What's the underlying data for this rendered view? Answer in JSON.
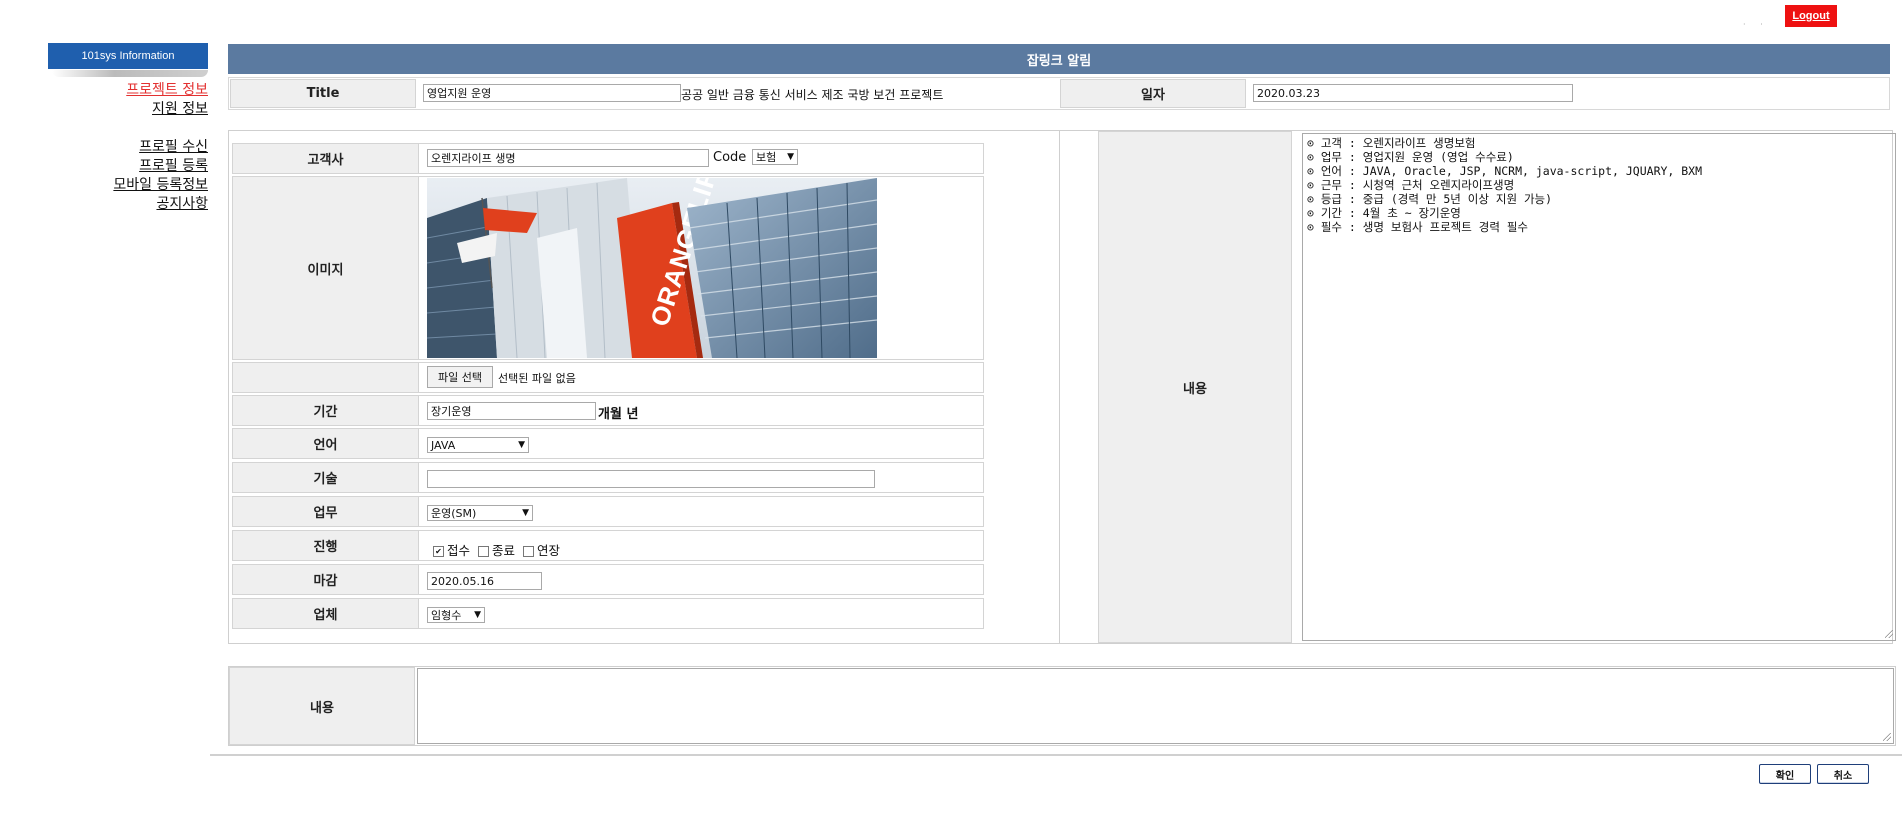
{
  "topbar": {
    "logout_label": "Logout",
    "dots": "· ·"
  },
  "sidebar": {
    "header": "101sys  Information",
    "items": [
      {
        "label": "프로젝트 정보",
        "active": true
      },
      {
        "label": "지원 정보"
      },
      {
        "label": "프로필 수신"
      },
      {
        "label": "프로필 등록"
      },
      {
        "label": "모바일 등록정보"
      },
      {
        "label": "공지사항"
      }
    ]
  },
  "header": {
    "title": "잡링크 알림"
  },
  "title_row": {
    "title_label": "Title",
    "title_value": "영업지원 운영",
    "categories": "공공 일반 금융 통신 서비스 제조 국방 보건 프로젝트",
    "date_label": "일자",
    "date_value": "2020.03.23"
  },
  "form": {
    "client": {
      "label": "고객사",
      "value": "오렌지라이프 생명",
      "code_label": "Code",
      "code_value": "보험"
    },
    "image": {
      "label": "이미지",
      "sign_text": "ORANGELIFE"
    },
    "file": {
      "button": "파일 선택",
      "status": "선택된 파일 없음"
    },
    "period": {
      "label": "기간",
      "value": "장기운영",
      "units": "개월 년"
    },
    "language": {
      "label": "언어",
      "value": "JAVA"
    },
    "tech": {
      "label": "기술",
      "value": ""
    },
    "task": {
      "label": "업무",
      "value": "운영(SM)"
    },
    "progress": {
      "label": "진행",
      "options": [
        {
          "label": "접수",
          "checked": true
        },
        {
          "label": "종료",
          "checked": false
        },
        {
          "label": "연장",
          "checked": false
        }
      ]
    },
    "deadline": {
      "label": "마감",
      "value": "2020.05.16"
    },
    "company": {
      "label": "업체",
      "value": "임형수"
    }
  },
  "content": {
    "label": "내용",
    "text": "⊙ 고객 : 오렌지라이프 생명보험\n⊙ 업무 : 영업지원 운영 (영업 수수료)\n⊙ 언어 : JAVA, Oracle, JSP, NCRM, java-script, JQUARY, BXM\n⊙ 근무 : 시청역 근처 오렌지라이프생명\n⊙ 등급 : 중급 (경력 만 5년 이상 지원 가능)\n⊙ 기간 : 4월 초 ~ 장기운영\n⊙ 필수 : 생명 보험사 프로젝트 경력 필수"
  },
  "bottom": {
    "label": "내용",
    "value": ""
  },
  "footer": {
    "confirm": "확인",
    "cancel": "취소"
  },
  "colors": {
    "header_bar": "#5b7aa0",
    "sidebar_header": "#1f5fae",
    "logout": "#ee1111",
    "active_link": "#e33030"
  }
}
